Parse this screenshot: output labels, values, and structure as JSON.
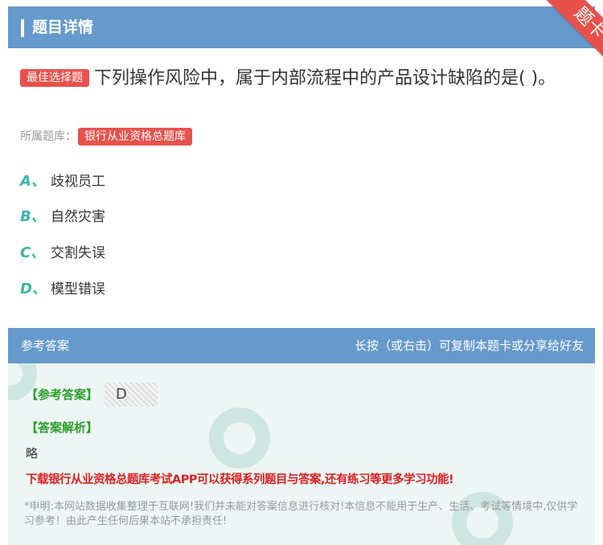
{
  "header": {
    "title": "题目详情"
  },
  "corner": {
    "label": "题卡"
  },
  "question": {
    "badge": "最佳选择题",
    "text": "下列操作风险中，属于内部流程中的产品设计缺陷的是( )。"
  },
  "bank": {
    "label": "所属题库：",
    "name": "银行从业资格总题库"
  },
  "options": [
    {
      "letter": "A、",
      "text": "歧视员工"
    },
    {
      "letter": "B、",
      "text": "自然灾害"
    },
    {
      "letter": "C、",
      "text": "交割失误"
    },
    {
      "letter": "D、",
      "text": "模型错误"
    }
  ],
  "answer_section": {
    "title": "参考答案",
    "tip": "长按（或右击）可复制本题卡或分享给好友",
    "answer_label": "【参考答案】",
    "answer_value": "D",
    "analysis_label": "【答案解析】",
    "analysis_text": "略",
    "download_text": "下载银行从业资格总题库考试APP可以获得系列题目与答案,还有练习等更多学习功能!",
    "disclaimer": "*申明:本网站数据收集整理于互联网!我们并未能对答案信息进行核对!本信息不能用于生产、生活、考试等情境中,仅供学习参考！由此产生任何后果本站不承担责任!"
  }
}
